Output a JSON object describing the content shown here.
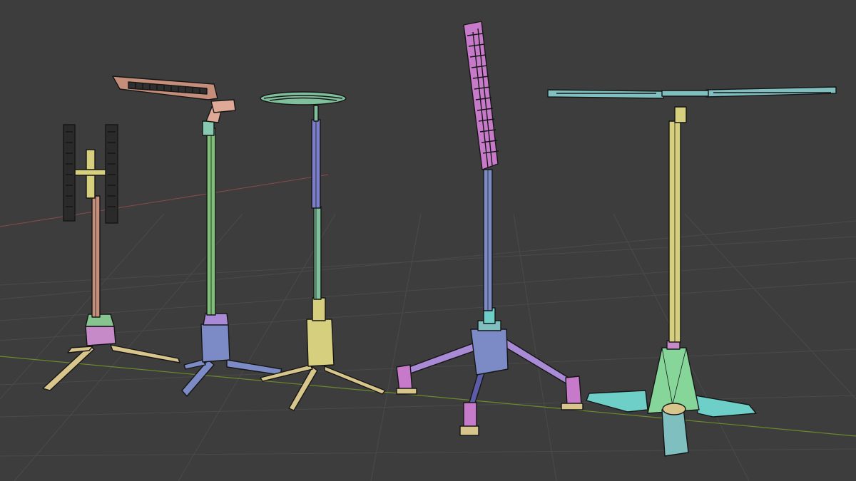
{
  "viewport": {
    "kind": "3d-viewport",
    "shading": "solid-random-color-wireframe",
    "background_color": "#3d3d3d",
    "grid_color": "#4b4b4b",
    "x_axis_color": "#8a4a4a",
    "y_axis_color": "#6c8a2a"
  },
  "objects": [
    {
      "name": "lamp-twin-bar",
      "colors": [
        "#c58e7a",
        "#d6cf7e",
        "#c68ac9",
        "#86c490",
        "#d8c58c"
      ]
    },
    {
      "name": "lamp-arm-panel",
      "colors": [
        "#e0a896",
        "#7fbf7a",
        "#7c8bc6",
        "#d8c58c"
      ]
    },
    {
      "name": "lamp-round-dish",
      "colors": [
        "#7fbf9c",
        "#7c7ec9",
        "#d6cf7e",
        "#d8c58c"
      ]
    },
    {
      "name": "lamp-tall-cylinder",
      "colors": [
        "#c77ac9",
        "#7c8bc6",
        "#a98ad6",
        "#d8c58c"
      ]
    },
    {
      "name": "lamp-t-bar-wide",
      "colors": [
        "#7fbfbf",
        "#d6cf7e",
        "#86d69a",
        "#6ecfc9"
      ]
    }
  ]
}
